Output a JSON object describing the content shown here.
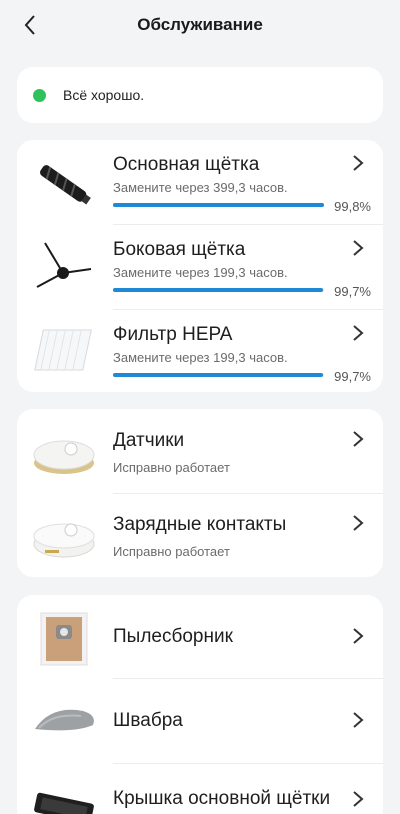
{
  "header": {
    "title": "Обслуживание"
  },
  "status": {
    "text": "Всё хорошо.",
    "color": "#2fc25b"
  },
  "consumables": [
    {
      "title": "Основная щётка",
      "subtitle": "Замените через 399,3 часов.",
      "percent_label": "99,8%",
      "percent": 99.8,
      "icon": "main-brush-icon"
    },
    {
      "title": "Боковая щётка",
      "subtitle": "Замените через 199,3 часов.",
      "percent_label": "99,7%",
      "percent": 99.7,
      "icon": "side-brush-icon"
    },
    {
      "title": "Фильтр HEPA",
      "subtitle": "Замените через 199,3 часов.",
      "percent_label": "99,7%",
      "percent": 99.7,
      "icon": "hepa-filter-icon"
    }
  ],
  "sensors": [
    {
      "title": "Датчики",
      "subtitle": "Исправно работает",
      "icon": "robot-sensors-icon"
    },
    {
      "title": "Зарядные контакты",
      "subtitle": "Исправно работает",
      "icon": "robot-charging-contacts-icon"
    }
  ],
  "accessories": [
    {
      "title": "Пылесборник",
      "icon": "dust-bag-icon"
    },
    {
      "title": "Швабра",
      "icon": "mop-pad-icon"
    },
    {
      "title": "Крышка основной щётки",
      "icon": "brush-cover-icon"
    }
  ],
  "colors": {
    "accent": "#1e8ad6",
    "background": "#f3f4f6",
    "card": "#ffffff"
  }
}
